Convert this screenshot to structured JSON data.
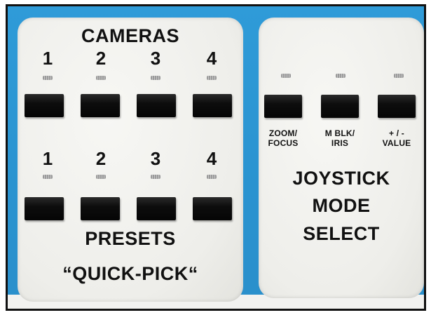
{
  "left_panel": {
    "cameras_title": "CAMERAS",
    "camera_numbers": [
      "1",
      "2",
      "3",
      "4"
    ],
    "preset_numbers": [
      "1",
      "2",
      "3",
      "4"
    ],
    "presets_title": "PRESETS",
    "quick_pick": "“QUICK-PICK“"
  },
  "right_panel": {
    "zoom_focus": [
      "ZOOM/",
      "FOCUS"
    ],
    "mblk_iris": [
      "M BLK/",
      "IRIS"
    ],
    "plus_minus_value": [
      "+ / -",
      "VALUE"
    ],
    "joystick": "JOYSTICK",
    "mode": "MODE",
    "select": "SELECT"
  },
  "colors": {
    "background_blue": "#2f9bd8",
    "panel": "#f1f1ee",
    "button": "#0a0a0a"
  }
}
